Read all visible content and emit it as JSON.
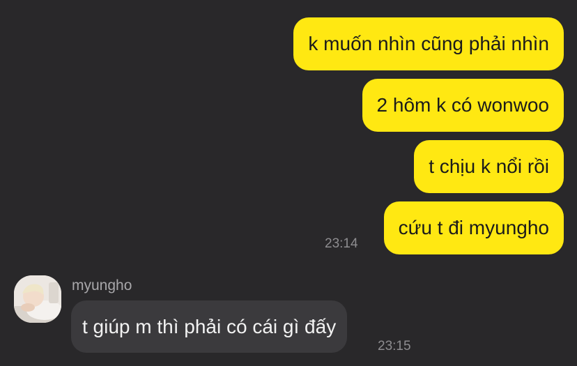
{
  "messages_out": [
    {
      "text": "k muốn nhìn cũng phải nhìn"
    },
    {
      "text": "2 hôm k có wonwoo"
    },
    {
      "text": "t chịu k nổi rồi"
    },
    {
      "text": "cứu t đi myungho"
    }
  ],
  "out_time": "23:14",
  "incoming": {
    "sender": "myungho",
    "text": "t giúp m thì phải có cái gì đấy",
    "time": "23:15"
  },
  "colors": {
    "background": "#29282a",
    "outgoing_bubble": "#ffe812",
    "incoming_bubble": "#3b3a3d"
  }
}
